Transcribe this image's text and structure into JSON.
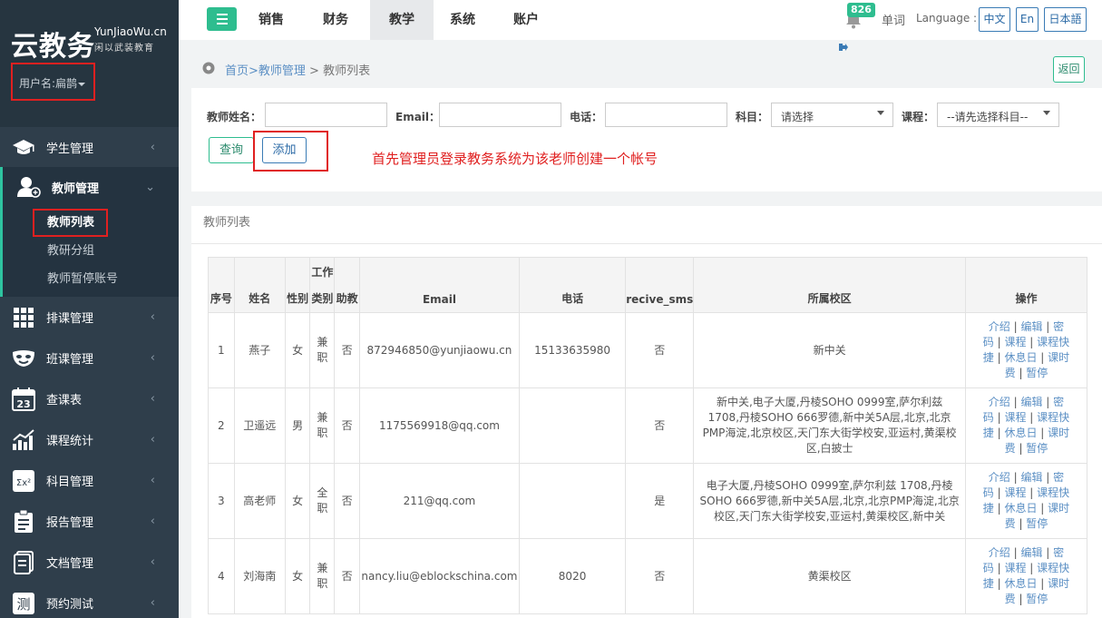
{
  "sidebar": {
    "logo_main": "云教务",
    "logo_en": "YunJiaoWu.cn",
    "logo_sub": "闲以武装教育",
    "user_label": "用户名:扁鹊",
    "menu": [
      {
        "label": "学生管理",
        "icon": "graduation-cap-icon"
      },
      {
        "label": "教师管理",
        "icon": "teacher-add-icon"
      },
      {
        "label": "排课管理",
        "icon": "grid-icon"
      },
      {
        "label": "班课管理",
        "icon": "mask-icon"
      },
      {
        "label": "查课表",
        "icon": "calendar-icon"
      },
      {
        "label": "课程统计",
        "icon": "bar-chart-icon"
      },
      {
        "label": "科目管理",
        "icon": "formula-icon"
      },
      {
        "label": "报告管理",
        "icon": "report-icon"
      },
      {
        "label": "文档管理",
        "icon": "document-icon"
      },
      {
        "label": "预约测试",
        "icon": "test-icon"
      }
    ],
    "teacher_submenu": [
      "教师列表",
      "教研分组",
      "教师暂停账号"
    ]
  },
  "topbar": {
    "tabs": [
      "销售",
      "财务",
      "教学",
      "系统",
      "账户"
    ],
    "active_tab": "教学",
    "notification_count": "826",
    "word_link": "单词",
    "language_label": "Language :",
    "languages": [
      "中文",
      "En",
      "日本語"
    ]
  },
  "breadcrumb": {
    "home": "首页",
    "parent": ">教师管理",
    "current": " > 教师列表",
    "back_label": "返回"
  },
  "filter": {
    "name_label": "教师姓名：",
    "email_label": "Email：",
    "phone_label": "电话：",
    "subject_label": "科目：",
    "subject_value": "请选择",
    "course_label": "课程：",
    "course_value": "--请先选择科目--",
    "query_button": "查询",
    "add_button": "添加",
    "annotation": "首先管理员登录教务系统为该老师创建一个帐号"
  },
  "list": {
    "title": "教师列表",
    "columns": {
      "index": "序号",
      "name": "姓名",
      "gender": "性别",
      "work": "工作",
      "type": "类别",
      "assistant": "助教",
      "email": "Email",
      "phone": "电话",
      "sms": "recive_sms",
      "campus": "所属校区",
      "ops": "操作"
    },
    "ops_labels": {
      "intro": "介绍",
      "edit": "编辑",
      "pw1": "密",
      "pw2": "码",
      "course": "课程",
      "quick1": "课程快",
      "quick2": "捷",
      "rest": "休息日",
      "fee1": "课时",
      "fee2": "费",
      "pause": "暂停"
    },
    "rows": [
      {
        "index": "1",
        "name": "燕子",
        "gender": "女",
        "type1": "兼",
        "type2": "职",
        "assistant": "否",
        "email": "872946850@yunjiaowu.cn",
        "phone": "15133635980",
        "sms": "否",
        "campus": "新中关"
      },
      {
        "index": "2",
        "name": "卫遥远",
        "gender": "男",
        "type1": "兼",
        "type2": "职",
        "assistant": "否",
        "email": "1175569918@qq.com",
        "phone": "",
        "sms": "否",
        "campus": "新中关,电子大厦,丹棱SOHO 0999室,萨尔利兹 1708,丹棱SOHO 666罗德,新中关5A层,北京,北京PMP海淀,北京校区,天门东大街学校安,亚运村,黄渠校区,白披士"
      },
      {
        "index": "3",
        "name": "高老师",
        "gender": "女",
        "type1": "全",
        "type2": "职",
        "assistant": "否",
        "email": "211@qq.com",
        "phone": "",
        "sms": "是",
        "campus": "电子大厦,丹棱SOHO 0999室,萨尔利兹 1708,丹棱SOHO 666罗德,新中关5A层,北京,北京PMP海淀,北京校区,天门东大街学校安,亚运村,黄渠校区,新中关"
      },
      {
        "index": "4",
        "name": "刘海南",
        "gender": "女",
        "type1": "兼",
        "type2": "职",
        "assistant": "否",
        "email": "nancy.liu@eblockschina.com",
        "phone": "8020",
        "sms": "否",
        "campus": "黄渠校区"
      }
    ]
  }
}
